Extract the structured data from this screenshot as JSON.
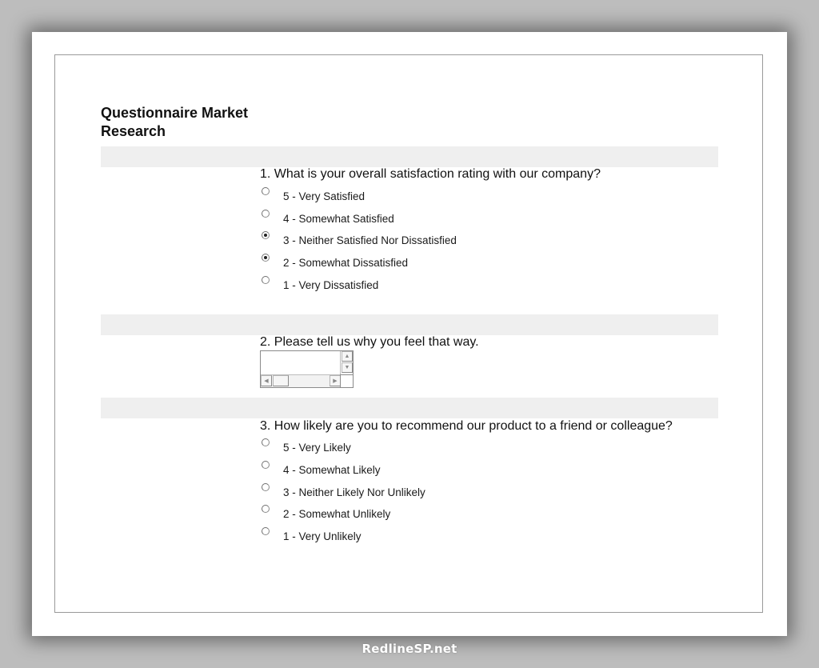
{
  "form": {
    "title": "Questionnaire Market Research",
    "questions": [
      {
        "number": 1,
        "text": "1. What is your overall satisfaction rating with our company?",
        "type": "radio",
        "options": [
          {
            "label": "5 - Very Satisfied",
            "checked": false
          },
          {
            "label": "4 - Somewhat Satisfied",
            "checked": false
          },
          {
            "label": "3 - Neither Satisfied Nor Dissatisfied",
            "checked": true
          },
          {
            "label": "2 - Somewhat Dissatisfied",
            "checked": true
          },
          {
            "label": "1 - Very Dissatisfied",
            "checked": false
          }
        ]
      },
      {
        "number": 2,
        "text": "2. Please tell us why you feel that way.",
        "type": "textarea",
        "value": "",
        "scroll_icons": {
          "up": "▲",
          "down": "▼",
          "left": "◀",
          "right": "▶"
        }
      },
      {
        "number": 3,
        "text": "3. How likely are you to recommend our product to a friend or colleague?",
        "type": "radio",
        "options": [
          {
            "label": "5 - Very Likely",
            "checked": false
          },
          {
            "label": "4 - Somewhat Likely",
            "checked": false
          },
          {
            "label": "3 - Neither Likely Nor Unlikely",
            "checked": false
          },
          {
            "label": "2 - Somewhat Unlikely",
            "checked": false
          },
          {
            "label": "1 - Very Unlikely",
            "checked": false
          }
        ]
      }
    ]
  },
  "watermark": "RedlineSP.net",
  "colors": {
    "background": "#bdbdbd",
    "card": "#ffffff",
    "band": "#efefef",
    "text": "#111111"
  }
}
